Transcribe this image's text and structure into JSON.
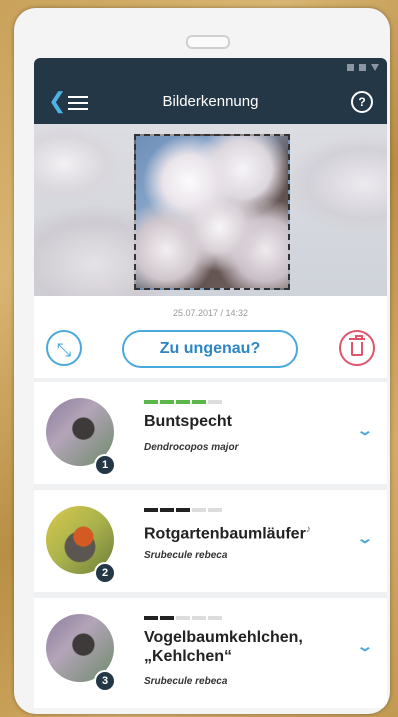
{
  "appbar": {
    "title": "Bilderkennung",
    "help": "?"
  },
  "photo": {
    "datetime": "25.07.2017 / 14:32"
  },
  "actions": {
    "inaccurate": "Zu ungenau?"
  },
  "results": [
    {
      "rank": "1",
      "name": "Buntspecht",
      "sci": "Dendrocopos major",
      "confidence": 4,
      "bar_color": "green"
    },
    {
      "rank": "2",
      "name": "Rotgartenbaumläufer",
      "sci": "Srubecule rebeca",
      "confidence": 3,
      "bar_color": "dark"
    },
    {
      "rank": "3",
      "name": "Vogelbaumkehlchen, „Kehlchen“",
      "sci": "Srubecule rebeca",
      "confidence": 2,
      "bar_color": "dark"
    }
  ]
}
